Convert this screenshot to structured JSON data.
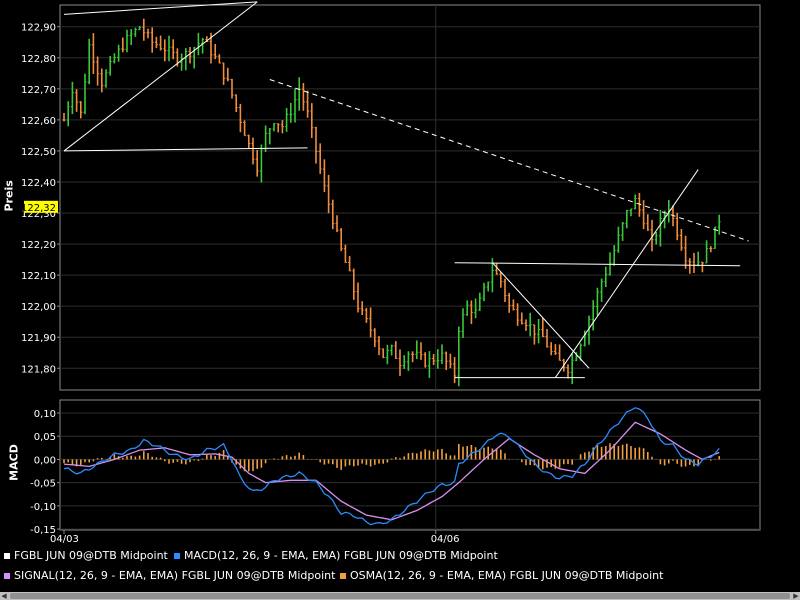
{
  "chart_data": [
    {
      "type": "line",
      "subtype": "ohlc-bars",
      "ylabel": "Preis",
      "ylim": [
        121.73,
        122.97
      ],
      "yticks": [
        "122,90",
        "122,80",
        "122,70",
        "122,60",
        "122,50",
        "122,40",
        "122,30",
        "122,20",
        "122,10",
        "122,00",
        "121,90",
        "121,80"
      ],
      "yticks_values": [
        122.9,
        122.8,
        122.7,
        122.6,
        122.5,
        122.4,
        122.3,
        122.2,
        122.1,
        122.0,
        121.9,
        121.8
      ],
      "xticks": [
        "04/03",
        "04/06"
      ],
      "grid": true,
      "current_price_label": "122,32",
      "series": [
        {
          "name": "FGBL JUN 09@DTB Midpoint",
          "color": "#ffffff",
          "up_color": "#3ac83a",
          "down_color": "#f08c3c",
          "anchors": [
            [
              0,
              122.6
            ],
            [
              2,
              122.7
            ],
            [
              4,
              122.62
            ],
            [
              6,
              122.84
            ],
            [
              9,
              122.72
            ],
            [
              12,
              122.8
            ],
            [
              15,
              122.86
            ],
            [
              18,
              122.9
            ],
            [
              21,
              122.85
            ],
            [
              24,
              122.83
            ],
            [
              27,
              122.8
            ],
            [
              30,
              122.82
            ],
            [
              33,
              122.86
            ],
            [
              36,
              122.8
            ],
            [
              39,
              122.72
            ],
            [
              42,
              122.6
            ],
            [
              44,
              122.52
            ],
            [
              46,
              122.45
            ],
            [
              48,
              122.55
            ],
            [
              50,
              122.6
            ],
            [
              52,
              122.58
            ],
            [
              54,
              122.63
            ],
            [
              56,
              122.7
            ],
            [
              58,
              122.62
            ],
            [
              60,
              122.5
            ],
            [
              62,
              122.38
            ],
            [
              64,
              122.28
            ],
            [
              66,
              122.18
            ],
            [
              68,
              122.1
            ],
            [
              70,
              122.0
            ],
            [
              72,
              121.95
            ],
            [
              74,
              121.9
            ],
            [
              76,
              121.84
            ],
            [
              78,
              121.86
            ],
            [
              80,
              121.82
            ],
            [
              82,
              121.85
            ],
            [
              84,
              121.84
            ],
            [
              86,
              121.82
            ],
            [
              88,
              121.83
            ],
            [
              90,
              121.84
            ],
            [
              92,
              121.8
            ],
            [
              93,
              121.78
            ],
            [
              94,
              121.93
            ],
            [
              96,
              122.0
            ],
            [
              98,
              121.98
            ],
            [
              100,
              122.05
            ],
            [
              102,
              122.12
            ],
            [
              104,
              122.08
            ],
            [
              106,
              122.0
            ],
            [
              108,
              121.97
            ],
            [
              110,
              121.95
            ],
            [
              112,
              121.92
            ],
            [
              114,
              121.9
            ],
            [
              116,
              121.85
            ],
            [
              118,
              121.82
            ],
            [
              120,
              121.8
            ],
            [
              122,
              121.85
            ],
            [
              124,
              121.92
            ],
            [
              126,
              122.0
            ],
            [
              128,
              122.08
            ],
            [
              130,
              122.14
            ],
            [
              132,
              122.22
            ],
            [
              134,
              122.3
            ],
            [
              136,
              122.34
            ],
            [
              138,
              122.28
            ],
            [
              140,
              122.2
            ],
            [
              142,
              122.27
            ],
            [
              144,
              122.32
            ],
            [
              146,
              122.24
            ],
            [
              148,
              122.16
            ],
            [
              150,
              122.14
            ],
            [
              152,
              122.15
            ],
            [
              154,
              122.2
            ],
            [
              156,
              122.28
            ]
          ]
        }
      ],
      "trendlines": [
        {
          "x1": 0,
          "y1": 122.5,
          "x2": 58,
          "y2": 122.51,
          "style": "solid"
        },
        {
          "x1": 0,
          "y1": 122.94,
          "x2": 46,
          "y2": 122.98,
          "style": "solid"
        },
        {
          "x1": 0,
          "y1": 122.5,
          "x2": 46,
          "y2": 122.98,
          "style": "solid"
        },
        {
          "x1": 49,
          "y1": 122.73,
          "x2": 163,
          "y2": 122.21,
          "style": "dashed"
        },
        {
          "x1": 93,
          "y1": 121.77,
          "x2": 124,
          "y2": 121.77,
          "style": "solid"
        },
        {
          "x1": 93,
          "y1": 122.14,
          "x2": 161,
          "y2": 122.13,
          "style": "solid"
        },
        {
          "x1": 102,
          "y1": 122.14,
          "x2": 125,
          "y2": 121.8,
          "style": "solid"
        },
        {
          "x1": 117,
          "y1": 121.77,
          "x2": 151,
          "y2": 122.44,
          "style": "solid"
        }
      ]
    },
    {
      "type": "line",
      "ylabel": "MACD",
      "ylim": [
        -0.152,
        0.128
      ],
      "yticks": [
        "0,10",
        "0,05",
        "0,00",
        "-0,05",
        "-0,10",
        "-0,15"
      ],
      "yticks_values": [
        0.1,
        0.05,
        0.0,
        -0.05,
        -0.1,
        -0.15
      ],
      "xticks": [
        "04/03",
        "04/06"
      ],
      "grid": true,
      "series": [
        {
          "name": "MACD(12, 26, 9 - EMA, EMA) FGBL JUN 09@DTB Midpoint",
          "color": "#2a8cff",
          "anchors": [
            [
              0,
              -0.02
            ],
            [
              4,
              -0.03
            ],
            [
              8,
              -0.01
            ],
            [
              12,
              0.01
            ],
            [
              16,
              0.02
            ],
            [
              19,
              0.04
            ],
            [
              22,
              0.03
            ],
            [
              26,
              0.01
            ],
            [
              30,
              0.0
            ],
            [
              34,
              0.02
            ],
            [
              38,
              0.03
            ],
            [
              40,
              0.0
            ],
            [
              42,
              -0.04
            ],
            [
              45,
              -0.07
            ],
            [
              48,
              -0.06
            ],
            [
              50,
              -0.045
            ],
            [
              52,
              -0.04
            ],
            [
              56,
              -0.03
            ],
            [
              60,
              -0.05
            ],
            [
              63,
              -0.08
            ],
            [
              66,
              -0.115
            ],
            [
              69,
              -0.12
            ],
            [
              72,
              -0.135
            ],
            [
              75,
              -0.14
            ],
            [
              78,
              -0.13
            ],
            [
              81,
              -0.11
            ],
            [
              84,
              -0.09
            ],
            [
              87,
              -0.07
            ],
            [
              90,
              -0.055
            ],
            [
              93,
              -0.05
            ],
            [
              94,
              -0.01
            ],
            [
              97,
              0.01
            ],
            [
              100,
              0.03
            ],
            [
              103,
              0.055
            ],
            [
              106,
              0.05
            ],
            [
              109,
              0.02
            ],
            [
              112,
              -0.01
            ],
            [
              115,
              -0.03
            ],
            [
              118,
              -0.04
            ],
            [
              121,
              -0.035
            ],
            [
              124,
              -0.01
            ],
            [
              127,
              0.03
            ],
            [
              130,
              0.06
            ],
            [
              133,
              0.09
            ],
            [
              136,
              0.115
            ],
            [
              139,
              0.09
            ],
            [
              142,
              0.04
            ],
            [
              145,
              0.03
            ],
            [
              148,
              0.0
            ],
            [
              151,
              -0.01
            ],
            [
              156,
              0.02
            ]
          ]
        },
        {
          "name": "SIGNAL(12, 26, 9 - EMA, EMA) FGBL JUN 09@DTB Midpoint",
          "color": "#d890f0",
          "anchors": [
            [
              0,
              -0.01
            ],
            [
              6,
              -0.015
            ],
            [
              12,
              0.0
            ],
            [
              18,
              0.02
            ],
            [
              24,
              0.025
            ],
            [
              30,
              0.01
            ],
            [
              36,
              0.012
            ],
            [
              40,
              0.005
            ],
            [
              44,
              -0.03
            ],
            [
              48,
              -0.05
            ],
            [
              54,
              -0.045
            ],
            [
              60,
              -0.045
            ],
            [
              66,
              -0.09
            ],
            [
              72,
              -0.12
            ],
            [
              78,
              -0.13
            ],
            [
              84,
              -0.11
            ],
            [
              90,
              -0.08
            ],
            [
              94,
              -0.05
            ],
            [
              100,
              0.0
            ],
            [
              106,
              0.045
            ],
            [
              112,
              0.01
            ],
            [
              118,
              -0.02
            ],
            [
              124,
              -0.03
            ],
            [
              130,
              0.02
            ],
            [
              136,
              0.08
            ],
            [
              142,
              0.055
            ],
            [
              148,
              0.02
            ],
            [
              152,
              0.0
            ],
            [
              156,
              0.015
            ]
          ]
        },
        {
          "name": "OSMA(12, 26, 9 - EMA, EMA) FGBL JUN 09@DTB Midpoint",
          "color": "#f0a040",
          "type": "histogram",
          "derived_from": "MACD - SIGNAL"
        }
      ]
    }
  ],
  "legend": [
    {
      "label": "FGBL JUN 09@DTB Midpoint",
      "color": "#ffffff"
    },
    {
      "label": "MACD(12, 26, 9 - EMA, EMA) FGBL JUN 09@DTB Midpoint",
      "color": "#2a8cff"
    },
    {
      "label": "SIGNAL(12, 26, 9 - EMA, EMA) FGBL JUN 09@DTB Midpoint",
      "color": "#d890f0"
    },
    {
      "label": "OSMA(12, 26, 9 - EMA, EMA) FGBL JUN 09@DTB Midpoint",
      "color": "#f0a040"
    }
  ],
  "colors": {
    "background": "#000000",
    "grid": "#2e2e2e",
    "axis": "#8a8a8a",
    "current_price_bg": "#ffff00"
  }
}
